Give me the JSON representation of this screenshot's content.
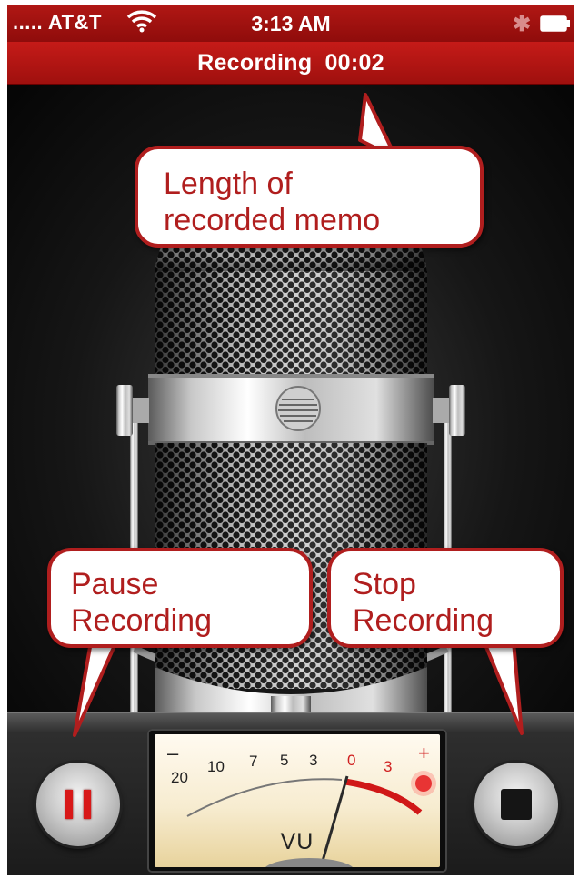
{
  "status_bar": {
    "carrier": "..... AT&T",
    "time": "3:13 AM",
    "wifi_icon": "wifi-icon",
    "bluetooth_icon": "bluetooth-icon",
    "battery_icon": "battery-icon"
  },
  "recording_banner": {
    "label": "Recording",
    "elapsed": "00:02"
  },
  "callouts": {
    "length": [
      "Length of",
      "recorded memo"
    ],
    "pause": [
      "Pause",
      "Recording"
    ],
    "stop": [
      "Stop",
      "Recording"
    ]
  },
  "controls": {
    "pause_icon": "pause-icon",
    "stop_icon": "stop-icon"
  },
  "vu_meter": {
    "label": "VU",
    "minus": "–",
    "plus": "+",
    "scale": [
      "20",
      "10",
      "7",
      "5",
      "3",
      "0",
      "3"
    ]
  },
  "colors": {
    "accent_red": "#b01e1e",
    "status_bar_red": "#b01714",
    "meter_face": "#f7ecd0"
  }
}
